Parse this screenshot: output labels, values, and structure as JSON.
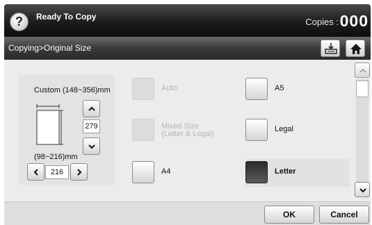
{
  "header": {
    "help_label": "?",
    "title": "Ready To Copy",
    "copies_label": "Copies :",
    "copies_count": "000"
  },
  "breadcrumb": {
    "path": "Copying>Original Size",
    "icons": [
      "output-tray-icon",
      "home-icon"
    ]
  },
  "custom_size": {
    "title": "Custom (148~356)mm",
    "height_value": "279",
    "width_range": "(98~216)mm",
    "width_value": "216"
  },
  "options": {
    "auto": {
      "label": "Auto",
      "enabled": false
    },
    "mixed": {
      "label_line1": "Mixed Size",
      "label_line2": "(Letter & Legal)",
      "enabled": false
    },
    "a4": {
      "label": "A4",
      "enabled": true
    },
    "a5": {
      "label": "A5",
      "enabled": true
    },
    "legal": {
      "label": "Legal",
      "enabled": true
    },
    "letter": {
      "label": "Letter",
      "enabled": true,
      "selected": true
    }
  },
  "footer": {
    "ok_label": "OK",
    "cancel_label": "Cancel"
  }
}
